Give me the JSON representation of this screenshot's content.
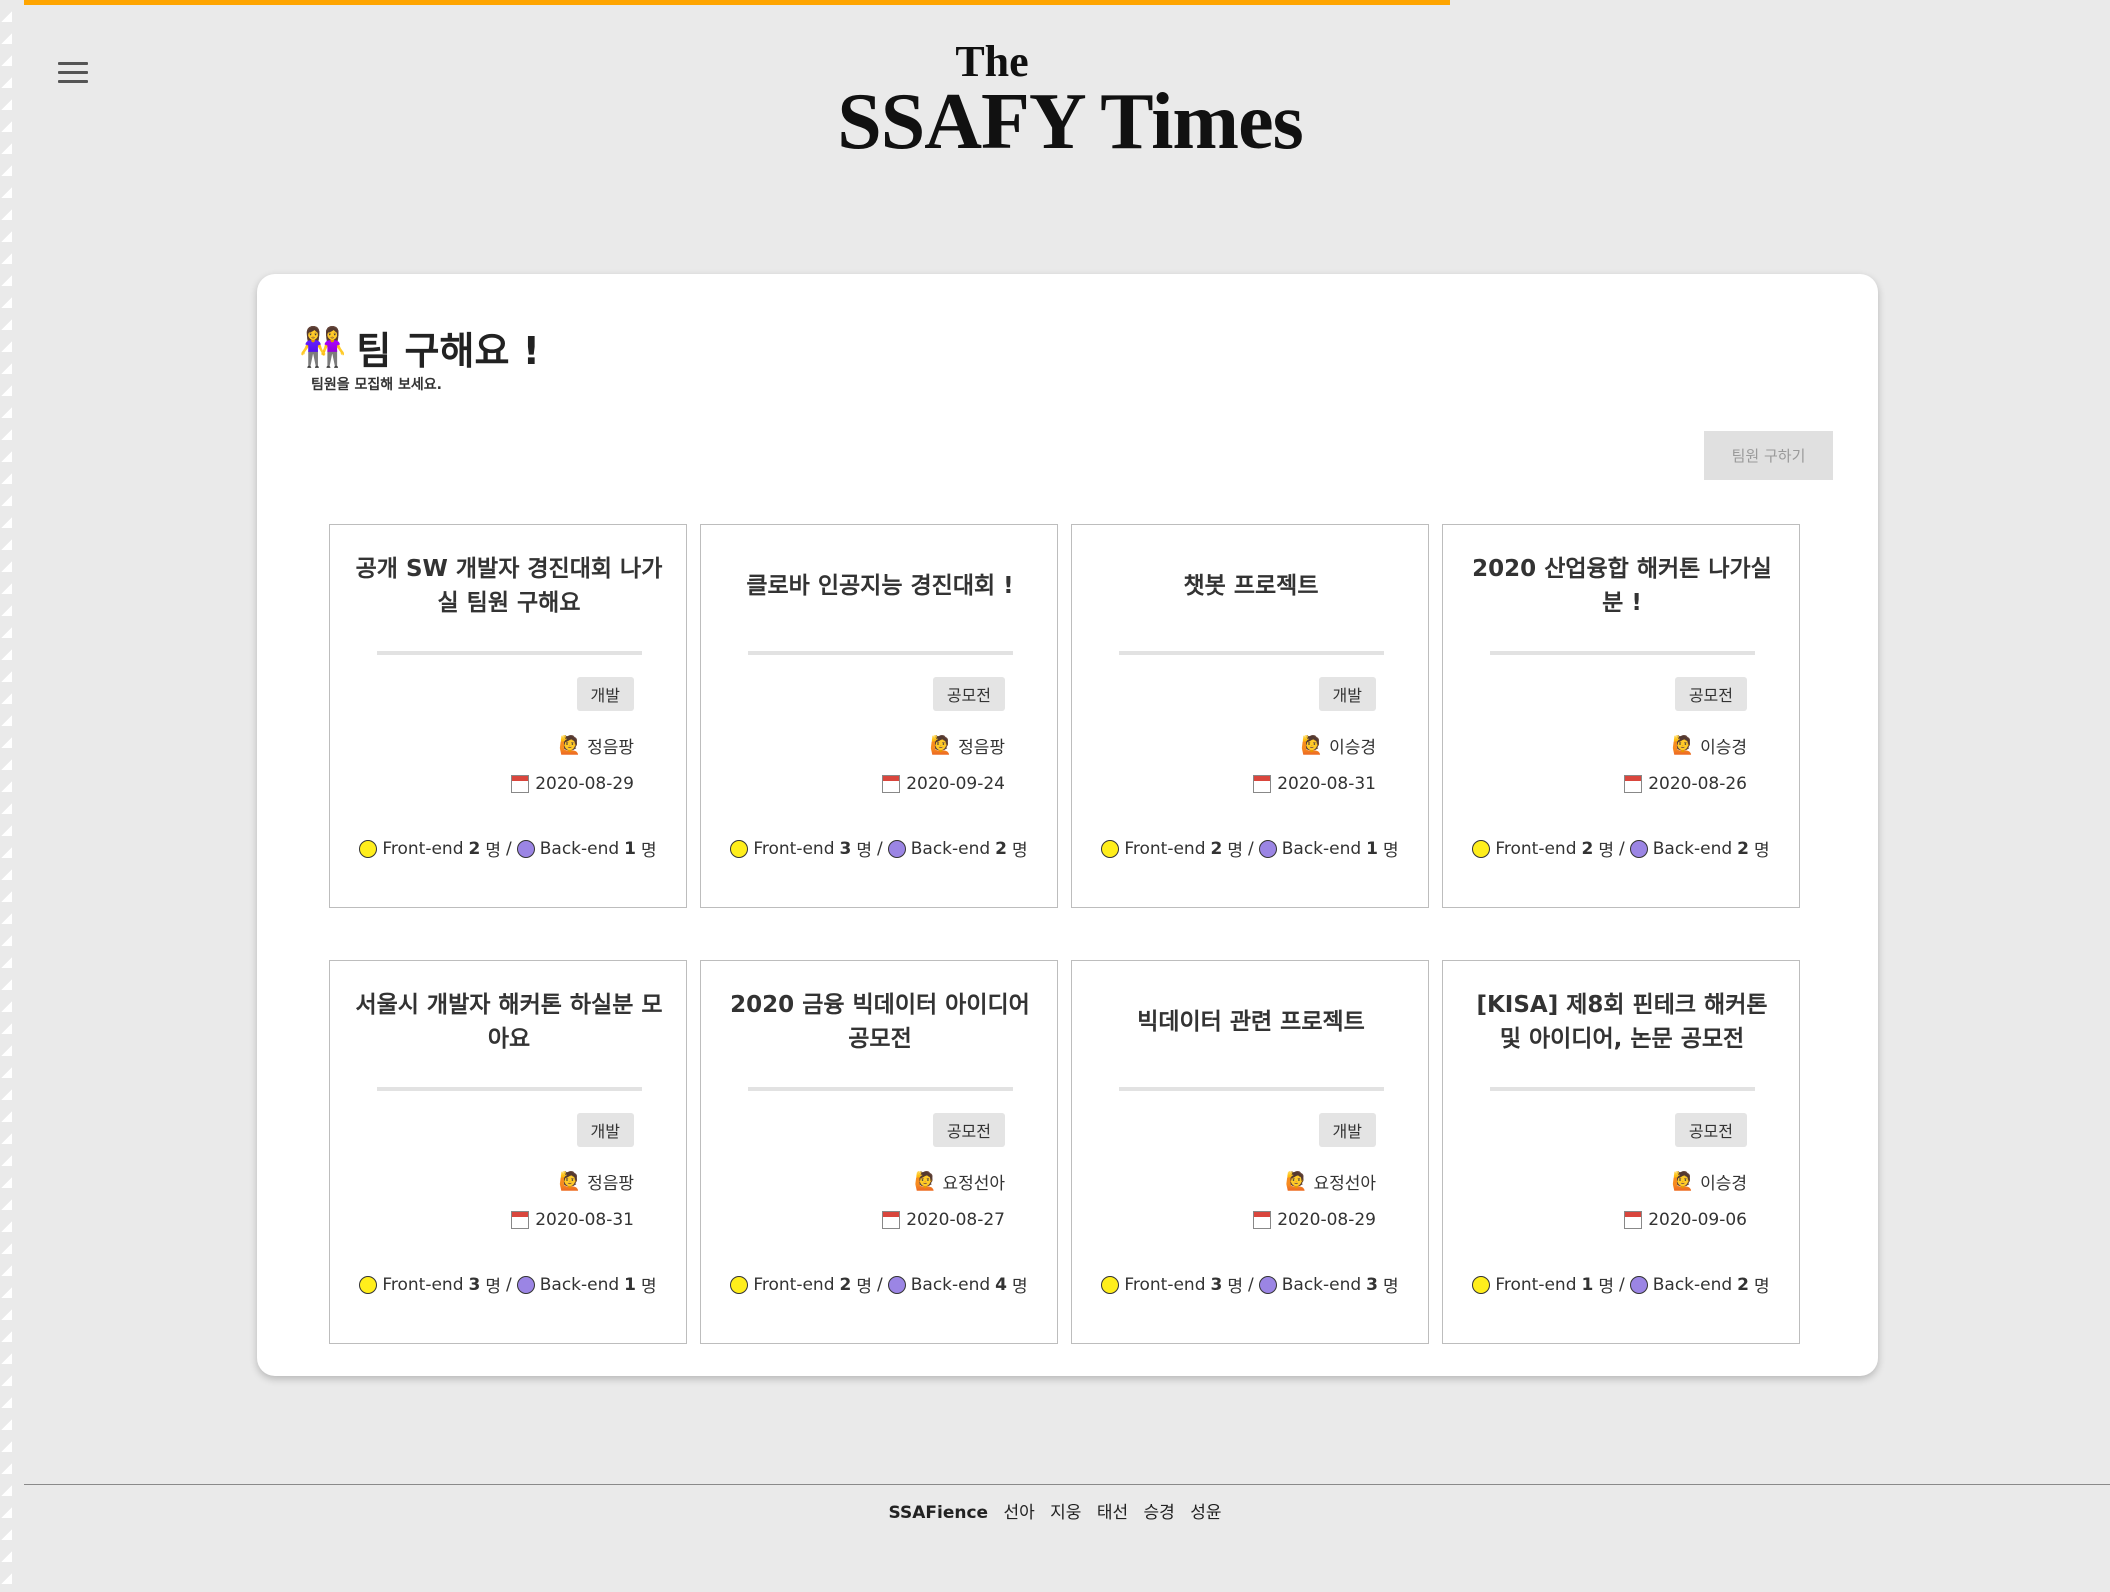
{
  "masthead": {
    "the": "The",
    "name": "SSAFY Times"
  },
  "panel": {
    "title_emoji": "👭",
    "title": "팀 구해요 !",
    "subtitle": "팀원을 모집해 보세요.",
    "find_button": "팀원 구하기"
  },
  "cards": [
    {
      "title": "공개 SW 개발자 경진대회 나가실 팀원 구해요",
      "tag": "개발",
      "author": "정음팡",
      "date": "2020-08-29",
      "fe_label": "Front-end",
      "fe_count": "2",
      "be_label": "Back-end",
      "be_count": "1",
      "unit": "명"
    },
    {
      "title": "클로바 인공지능 경진대회 !",
      "tag": "공모전",
      "author": "정음팡",
      "date": "2020-09-24",
      "fe_label": "Front-end",
      "fe_count": "3",
      "be_label": "Back-end",
      "be_count": "2",
      "unit": "명"
    },
    {
      "title": "챗봇 프로젝트",
      "tag": "개발",
      "author": "이승경",
      "date": "2020-08-31",
      "fe_label": "Front-end",
      "fe_count": "2",
      "be_label": "Back-end",
      "be_count": "1",
      "unit": "명"
    },
    {
      "title": "2020 산업융합 해커톤 나가실 분 !",
      "tag": "공모전",
      "author": "이승경",
      "date": "2020-08-26",
      "fe_label": "Front-end",
      "fe_count": "2",
      "be_label": "Back-end",
      "be_count": "2",
      "unit": "명"
    },
    {
      "title": "서울시 개발자 해커톤 하실분 모아요",
      "tag": "개발",
      "author": "정음팡",
      "date": "2020-08-31",
      "fe_label": "Front-end",
      "fe_count": "3",
      "be_label": "Back-end",
      "be_count": "1",
      "unit": "명"
    },
    {
      "title": "2020 금융 빅데이터 아이디어 공모전",
      "tag": "공모전",
      "author": "요정선아",
      "date": "2020-08-27",
      "fe_label": "Front-end",
      "fe_count": "2",
      "be_label": "Back-end",
      "be_count": "4",
      "unit": "명"
    },
    {
      "title": "빅데이터 관련 프로젝트",
      "tag": "개발",
      "author": "요정선아",
      "date": "2020-08-29",
      "fe_label": "Front-end",
      "fe_count": "3",
      "be_label": "Back-end",
      "be_count": "3",
      "unit": "명"
    },
    {
      "title": "[KISA] 제8회 핀테크 해커톤 및 아이디어, 논문 공모전",
      "tag": "공모전",
      "author": "이승경",
      "date": "2020-09-06",
      "fe_label": "Front-end",
      "fe_count": "1",
      "be_label": "Back-end",
      "be_count": "2",
      "unit": "명"
    }
  ],
  "icons": {
    "menu": "hamburger-menu-icon",
    "author": "person-raising-hand-icon",
    "date": "calendar-icon",
    "frontend": "yellow-circle-icon",
    "backend": "purple-circle-icon"
  },
  "colors": {
    "progress": "#ffa500",
    "frontend": "#ffee1c",
    "backend": "#9b85e4",
    "background": "#eaeaea"
  },
  "footer": {
    "brand": "SSAFience",
    "members": [
      "선아",
      "지웅",
      "태선",
      "승경",
      "성윤"
    ]
  }
}
